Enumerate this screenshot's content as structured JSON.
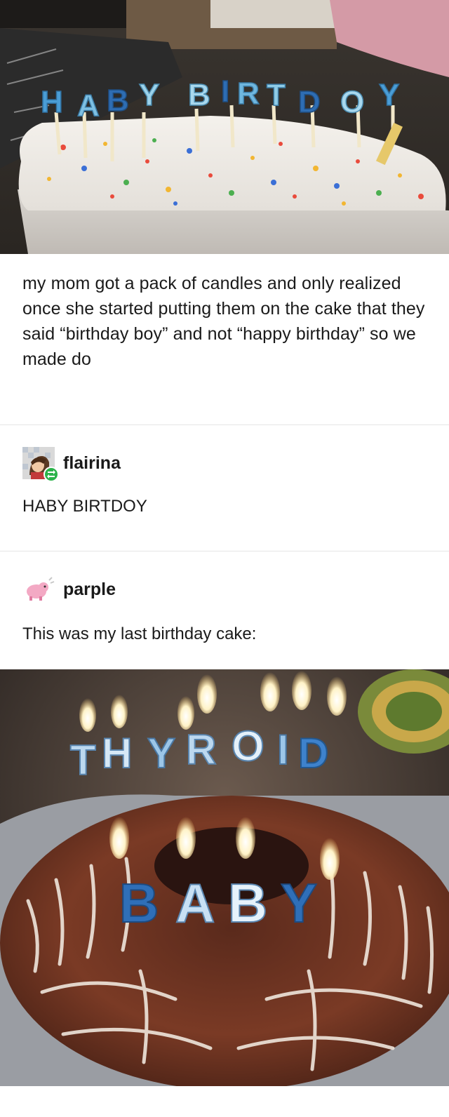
{
  "post": {
    "text": "my mom got a pack of candles and only realized once she started putting them on the cake that they said “birthday boy” and not “happy birthday” so we made do"
  },
  "photos": {
    "first_candles": "HABY BIRTDOY",
    "second_candles_top": "THYROID",
    "second_candles_bottom": "BABY"
  },
  "reblogs": [
    {
      "username": "flairina",
      "text": "HABY BIRTDOY",
      "reblog_icon": "reblog-icon"
    },
    {
      "username": "parple",
      "text": "This was my last birthday cake:"
    }
  ],
  "colors": {
    "reblog_badge": "#2bb34a",
    "divider": "#e6e6e6",
    "text": "#1a1a1a"
  }
}
